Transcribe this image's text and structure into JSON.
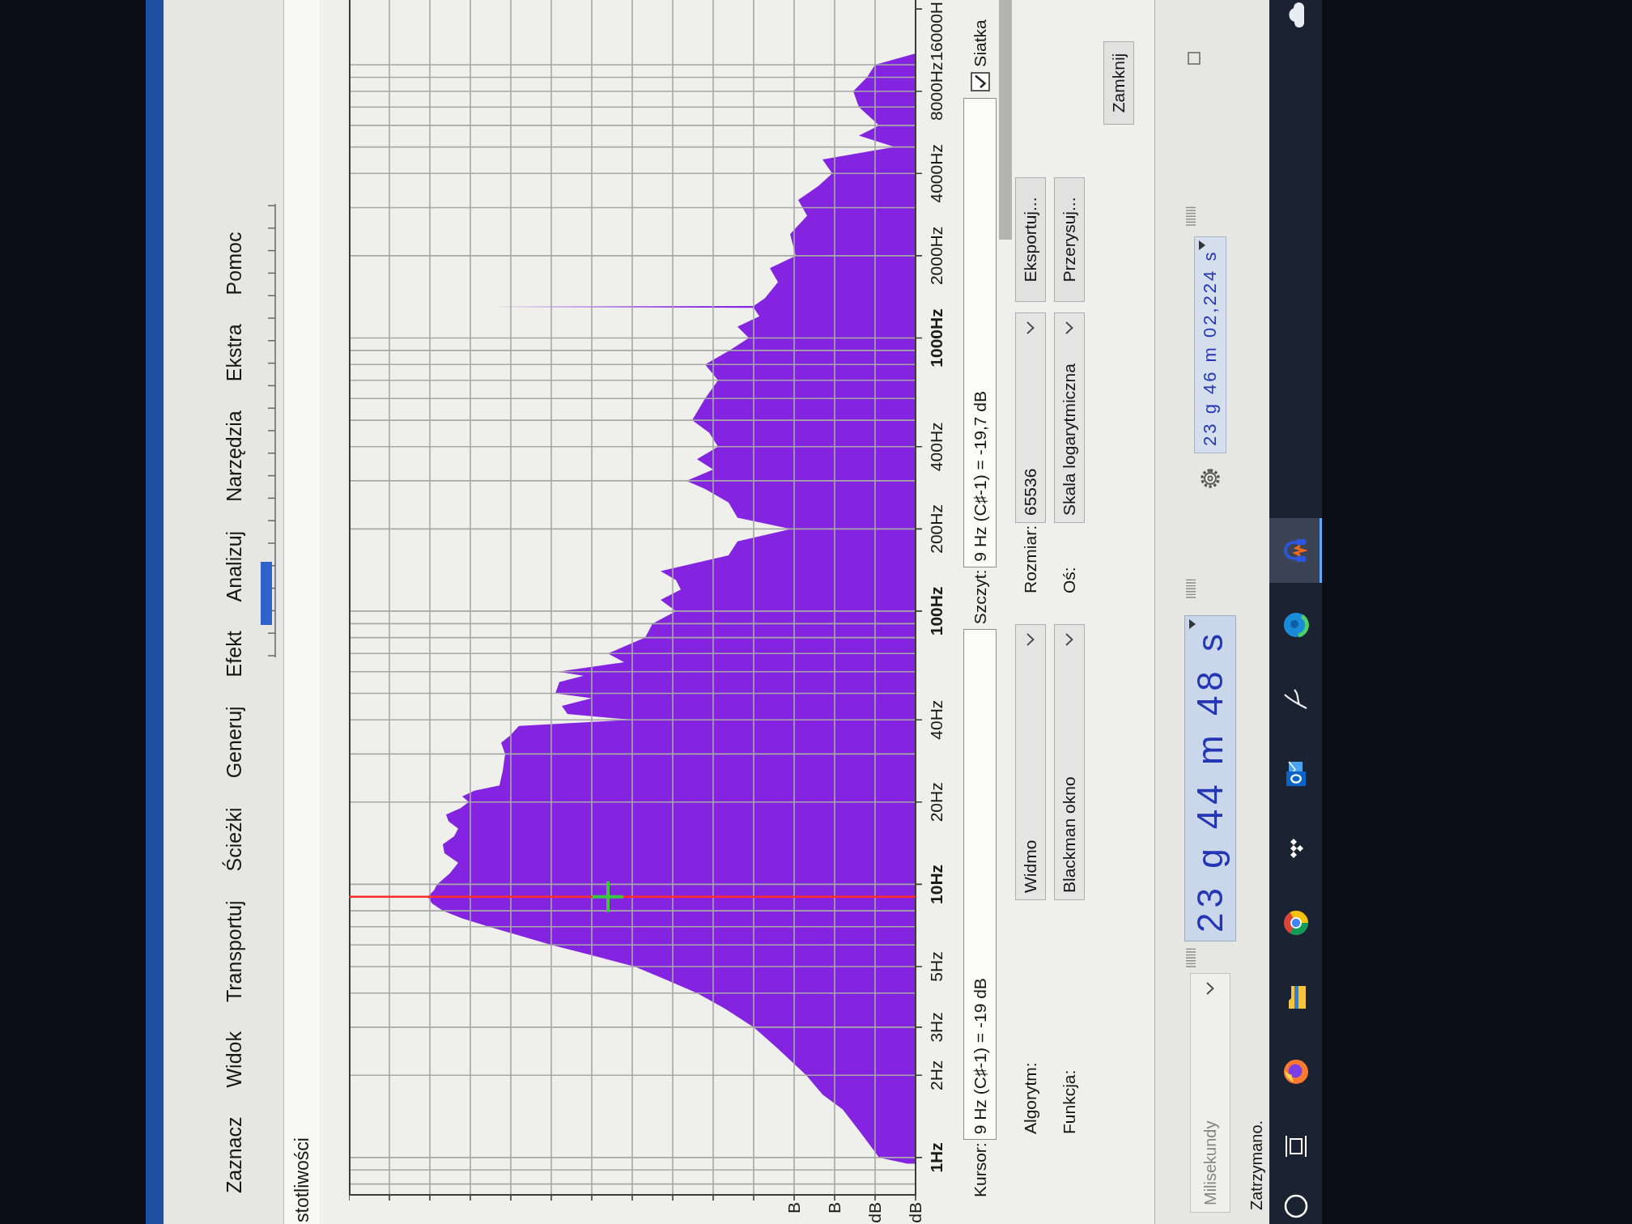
{
  "menu_bar": {
    "items": [
      "Zaznacz",
      "Widok",
      "Transportuj",
      "Ścieżki",
      "Generuj",
      "Efekt",
      "Analizuj",
      "Narzędzia",
      "Ekstra",
      "Pomoc"
    ]
  },
  "frequency_window": {
    "title": "stotliwości",
    "plot": {
      "frequency_labels": [
        "1Hz",
        "2Hz",
        "3Hz",
        "5Hz",
        "10Hz",
        "20Hz",
        "40Hz",
        "100Hz",
        "200Hz",
        "400Hz",
        "1000Hz",
        "2000Hz",
        "4000Hz",
        "8000Hz",
        "16000H"
      ],
      "level_labels": [
        "dB",
        "dB",
        "B",
        "B"
      ]
    },
    "cursor": {
      "label": "Kursor:",
      "value": "9 Hz (C♯-1) = -19 dB"
    },
    "peak": {
      "label": "Szczyt:",
      "value": "9 Hz (C♯-1) = -19,7 dB"
    },
    "grid": {
      "label": "Siatka",
      "checked": true
    },
    "algorithm": {
      "label": "Algorytm:",
      "value": "Widmo"
    },
    "size": {
      "label": "Rozmiar:",
      "value": "65536"
    },
    "export_button": "Eksportuj...",
    "window_function": {
      "label": "Funkcja:",
      "value": "Blackman okno"
    },
    "axis": {
      "label": "Oś:",
      "value": "Skala logarytmiczna"
    },
    "redraw_button": "Przerysuj...",
    "close_button": "Zamknij"
  },
  "selection_toolbar": {
    "format": "Milisekundy",
    "time": "23 g 44 m 48 s",
    "selection": "23 g 46 m 02,224 s"
  },
  "status_bar": {
    "text": "Zatrzymano."
  },
  "taskbar": {
    "items": [
      {
        "selected": false
      },
      {
        "selected": false
      },
      {
        "selected": false
      },
      {
        "selected": false
      },
      {
        "selected": false
      },
      {
        "selected": false
      },
      {
        "selected": false
      },
      {
        "selected": false
      },
      {
        "selected": false
      },
      {
        "selected": true
      }
    ]
  }
}
